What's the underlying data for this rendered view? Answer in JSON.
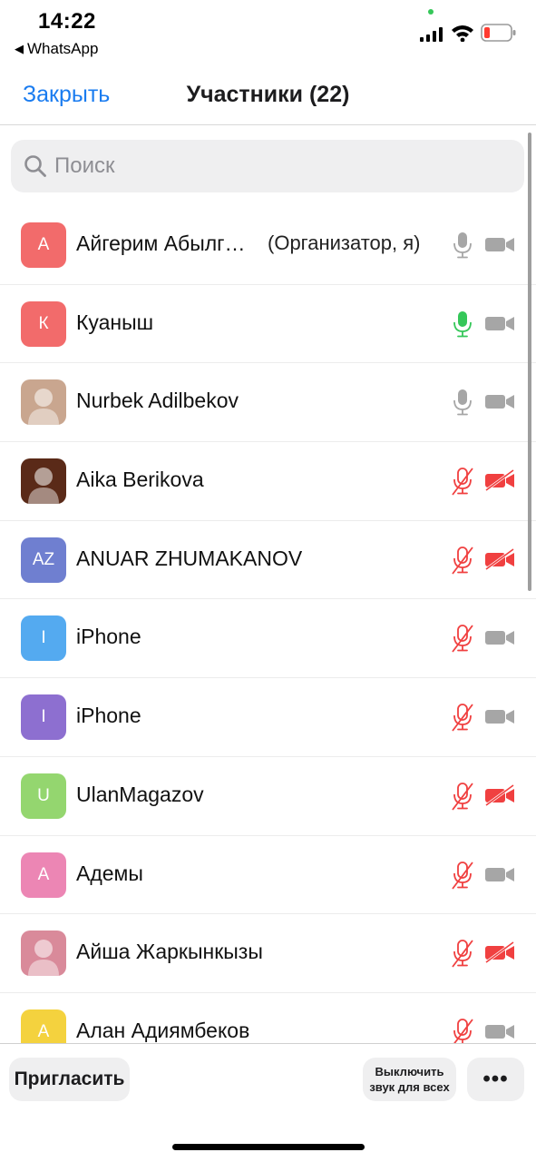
{
  "status": {
    "time": "14:22",
    "back_app": "WhatsApp",
    "back_icon": "back-triangle-icon"
  },
  "nav": {
    "close_label": "Закрыть",
    "title": "Участники (22)"
  },
  "search": {
    "placeholder": "Поиск",
    "value": ""
  },
  "colors": {
    "accent": "#1a7cf0",
    "mic_active": "#35c759",
    "muted_red": "#f04040",
    "icon_gray": "#a6a6a6"
  },
  "participants": [
    {
      "initials": "А",
      "avatar_color": "#f26b6b",
      "name": "Айгерим Абылг…",
      "role": "(Организатор, я)",
      "mic": "on",
      "video": "on"
    },
    {
      "initials": "К",
      "avatar_color": "#f26b6b",
      "name": "Куаныш",
      "role": "",
      "mic": "speaking",
      "video": "on"
    },
    {
      "initials": "",
      "avatar_color": "#c9a68f",
      "name": "Nurbek Adilbekov",
      "role": "",
      "mic": "on",
      "video": "on"
    },
    {
      "initials": "",
      "avatar_color": "#5a2a18",
      "name": "Aika Berikova",
      "role": "",
      "mic": "muted",
      "video": "off"
    },
    {
      "initials": "AZ",
      "avatar_color": "#6f7fd0",
      "name": "ANUAR ZHUMAKANOV",
      "role": "",
      "mic": "muted",
      "video": "off"
    },
    {
      "initials": "I",
      "avatar_color": "#54aaf0",
      "name": "iPhone",
      "role": "",
      "mic": "muted",
      "video": "on"
    },
    {
      "initials": "I",
      "avatar_color": "#8d6fd0",
      "name": "iPhone",
      "role": "",
      "mic": "muted",
      "video": "on"
    },
    {
      "initials": "U",
      "avatar_color": "#94d66f",
      "name": "UlanMagazov",
      "role": "",
      "mic": "muted",
      "video": "off"
    },
    {
      "initials": "А",
      "avatar_color": "#ec86b4",
      "name": "Адемы",
      "role": "",
      "mic": "muted",
      "video": "on"
    },
    {
      "initials": "",
      "avatar_color": "#d98a9a",
      "name": "Айша Жаркынкызы",
      "role": "",
      "mic": "muted",
      "video": "off"
    },
    {
      "initials": "А",
      "avatar_color": "#f4d23e",
      "name": "Алан Адиямбеков",
      "role": "",
      "mic": "muted",
      "video": "on"
    }
  ],
  "toolbar": {
    "invite_label": "Пригласить",
    "mute_all_label": "Выключить звук для всех",
    "more_label": "•••"
  }
}
